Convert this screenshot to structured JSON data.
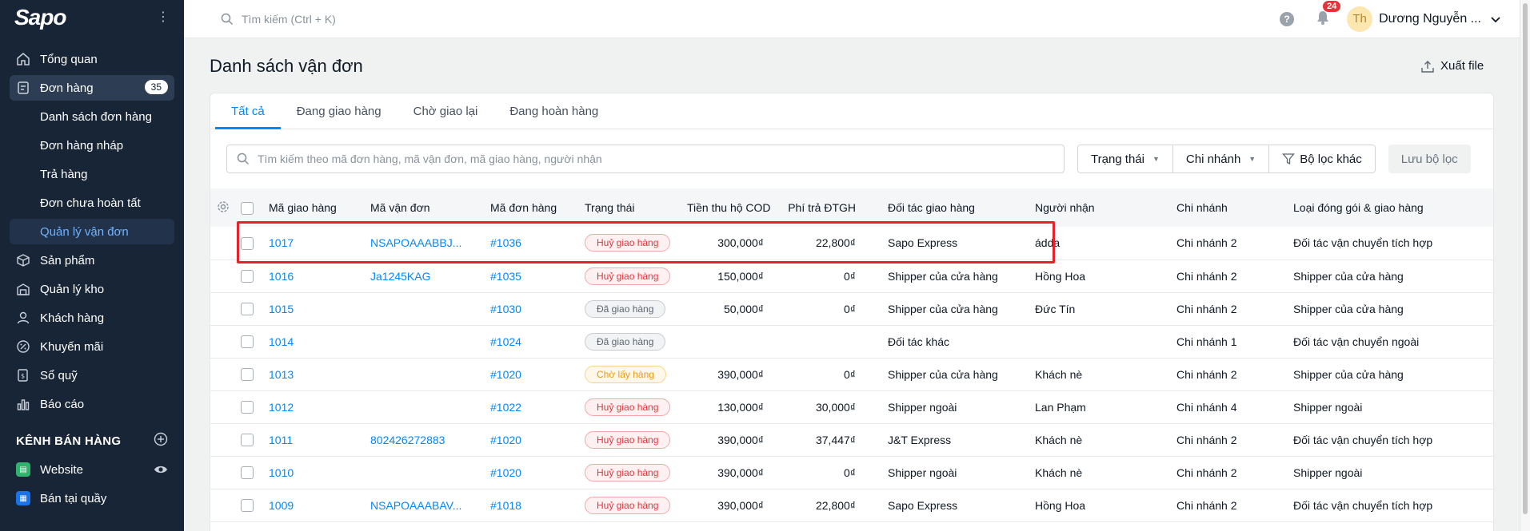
{
  "brand": {
    "logo": "Sapo"
  },
  "sidebar": {
    "items": [
      {
        "label": "Tổng quan",
        "icon": "home-icon"
      },
      {
        "label": "Đơn hàng",
        "icon": "order-icon",
        "badge": "35"
      },
      {
        "label": "Sản phẩm",
        "icon": "product-icon"
      },
      {
        "label": "Quản lý kho",
        "icon": "warehouse-icon"
      },
      {
        "label": "Khách hàng",
        "icon": "customer-icon"
      },
      {
        "label": "Khuyến mãi",
        "icon": "promotion-icon"
      },
      {
        "label": "Sổ quỹ",
        "icon": "cashbook-icon"
      },
      {
        "label": "Báo cáo",
        "icon": "report-icon"
      }
    ],
    "sub_items": [
      "Danh sách đơn hàng",
      "Đơn hàng nháp",
      "Trả hàng",
      "Đơn chưa hoàn tất",
      "Quản lý vận đơn"
    ],
    "channels_title": "KÊNH BÁN HÀNG",
    "channels": [
      {
        "label": "Website",
        "color": "#2fb36e"
      },
      {
        "label": "Bán tại quầy",
        "color": "#1a73e8"
      }
    ]
  },
  "topbar": {
    "search_placeholder": "Tìm kiếm (Ctrl + K)",
    "notification_count": "24",
    "avatar_initials": "Th",
    "user_name": "Dương Nguyễn ..."
  },
  "page": {
    "title": "Danh sách vận đơn",
    "export_label": "Xuất file"
  },
  "tabs": [
    "Tất cả",
    "Đang giao hàng",
    "Chờ giao lại",
    "Đang hoàn hàng"
  ],
  "filters": {
    "search_placeholder": "Tìm kiếm theo mã đơn hàng, mã vận đơn, mã giao hàng, người nhận",
    "status": "Trạng thái",
    "branch": "Chi nhánh",
    "other": "Bộ lọc khác",
    "save": "Lưu bộ lọc"
  },
  "table": {
    "columns": [
      "Mã giao hàng",
      "Mã vận đơn",
      "Mã đơn hàng",
      "Trạng thái",
      "Tiền thu hộ COD",
      "Phí trả ĐTGH",
      "Đối tác giao hàng",
      "Người nhận",
      "Chi nhánh",
      "Loại đóng gói & giao hàng"
    ],
    "rows": [
      {
        "ship": "1017",
        "waybill": "NSAPOAAABBJ...",
        "order": "#1036",
        "status": "Huỷ giao hàng",
        "status_type": "red",
        "cod": "300,000₫",
        "fee": "22,800₫",
        "partner": "Sapo Express",
        "receiver": "ádda",
        "branch": "Chi nhánh 2",
        "pack": "Đối tác vận chuyển tích hợp"
      },
      {
        "ship": "1016",
        "waybill": "Ja1245KAG",
        "order": "#1035",
        "status": "Huỷ giao hàng",
        "status_type": "red",
        "cod": "150,000₫",
        "fee": "0₫",
        "partner": "Shipper của cửa hàng",
        "receiver": "Hồng Hoa",
        "branch": "Chi nhánh 2",
        "pack": "Shipper của cửa hàng"
      },
      {
        "ship": "1015",
        "waybill": "",
        "order": "#1030",
        "status": "Đã giao hàng",
        "status_type": "gray",
        "cod": "50,000₫",
        "fee": "0₫",
        "partner": "Shipper của cửa hàng",
        "receiver": "Đức Tín",
        "branch": "Chi nhánh 2",
        "pack": "Shipper của cửa hàng"
      },
      {
        "ship": "1014",
        "waybill": "",
        "order": "#1024",
        "status": "Đã giao hàng",
        "status_type": "gray",
        "cod": "",
        "fee": "",
        "partner": "Đối tác khác",
        "receiver": "",
        "branch": "Chi nhánh 1",
        "pack": "Đối tác vận chuyển ngoài"
      },
      {
        "ship": "1013",
        "waybill": "",
        "order": "#1020",
        "status": "Chờ lấy hàng",
        "status_type": "orange",
        "cod": "390,000₫",
        "fee": "0₫",
        "partner": "Shipper của cửa hàng",
        "receiver": "Khách nè",
        "branch": "Chi nhánh 2",
        "pack": "Shipper của cửa hàng"
      },
      {
        "ship": "1012",
        "waybill": "",
        "order": "#1022",
        "status": "Huỷ giao hàng",
        "status_type": "red",
        "cod": "130,000₫",
        "fee": "30,000₫",
        "partner": "Shipper ngoài",
        "receiver": "Lan Phạm",
        "branch": "Chi nhánh 4",
        "pack": "Shipper ngoài"
      },
      {
        "ship": "1011",
        "waybill": "802426272883",
        "order": "#1020",
        "status": "Huỷ giao hàng",
        "status_type": "red",
        "cod": "390,000₫",
        "fee": "37,447₫",
        "partner": "J&T Express",
        "receiver": "Khách nè",
        "branch": "Chi nhánh 2",
        "pack": "Đối tác vận chuyển tích hợp"
      },
      {
        "ship": "1010",
        "waybill": "",
        "order": "#1020",
        "status": "Huỷ giao hàng",
        "status_type": "red",
        "cod": "390,000₫",
        "fee": "0₫",
        "partner": "Shipper ngoài",
        "receiver": "Khách nè",
        "branch": "Chi nhánh 2",
        "pack": "Shipper ngoài"
      },
      {
        "ship": "1009",
        "waybill": "NSAPOAAABAV...",
        "order": "#1018",
        "status": "Huỷ giao hàng",
        "status_type": "red",
        "cod": "390,000₫",
        "fee": "22,800₫",
        "partner": "Sapo Express",
        "receiver": "Hồng Hoa",
        "branch": "Chi nhánh 2",
        "pack": "Đối tác vận chuyển tích hợp"
      }
    ]
  },
  "colors": {
    "sidebar_bg": "#182537",
    "accent": "#0088ff",
    "highlight_box": "#e8202a"
  }
}
